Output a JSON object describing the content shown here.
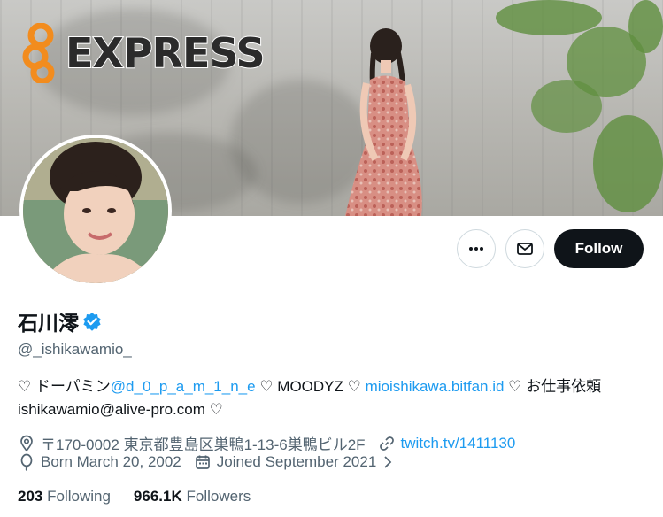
{
  "watermark": {
    "text": "EXPRESS"
  },
  "profile": {
    "display_name": "石川澪",
    "handle": "@_ishikawamio_",
    "verified": true
  },
  "actions": {
    "more_icon": "more-horizontal-icon",
    "message_icon": "mail-icon",
    "follow_label": "Follow"
  },
  "bio": {
    "heart1": "♡ ドーパミン",
    "mention": "@d_0_p_a_m_1_n_e",
    "heart2": " ♡ MOODYZ ♡ ",
    "link": "mioishikawa.bitfan.id",
    "heart3": " ♡ お仕事依頼 ishikawamio@alive-pro.com ♡"
  },
  "meta": {
    "location": "〒170-0002 東京都豊島区巣鴨1-13-6巣鴨ビル2F",
    "website": "twitch.tv/1411130",
    "birthday": "Born March 20, 2002",
    "joined": "Joined September 2021"
  },
  "stats": {
    "following_count": "203",
    "following_label": "Following",
    "followers_count": "966.1K",
    "followers_label": "Followers"
  },
  "colors": {
    "accent": "#1d9bf0",
    "text": "#0f1419",
    "muted": "#536471",
    "button_dark": "#0f1419"
  }
}
